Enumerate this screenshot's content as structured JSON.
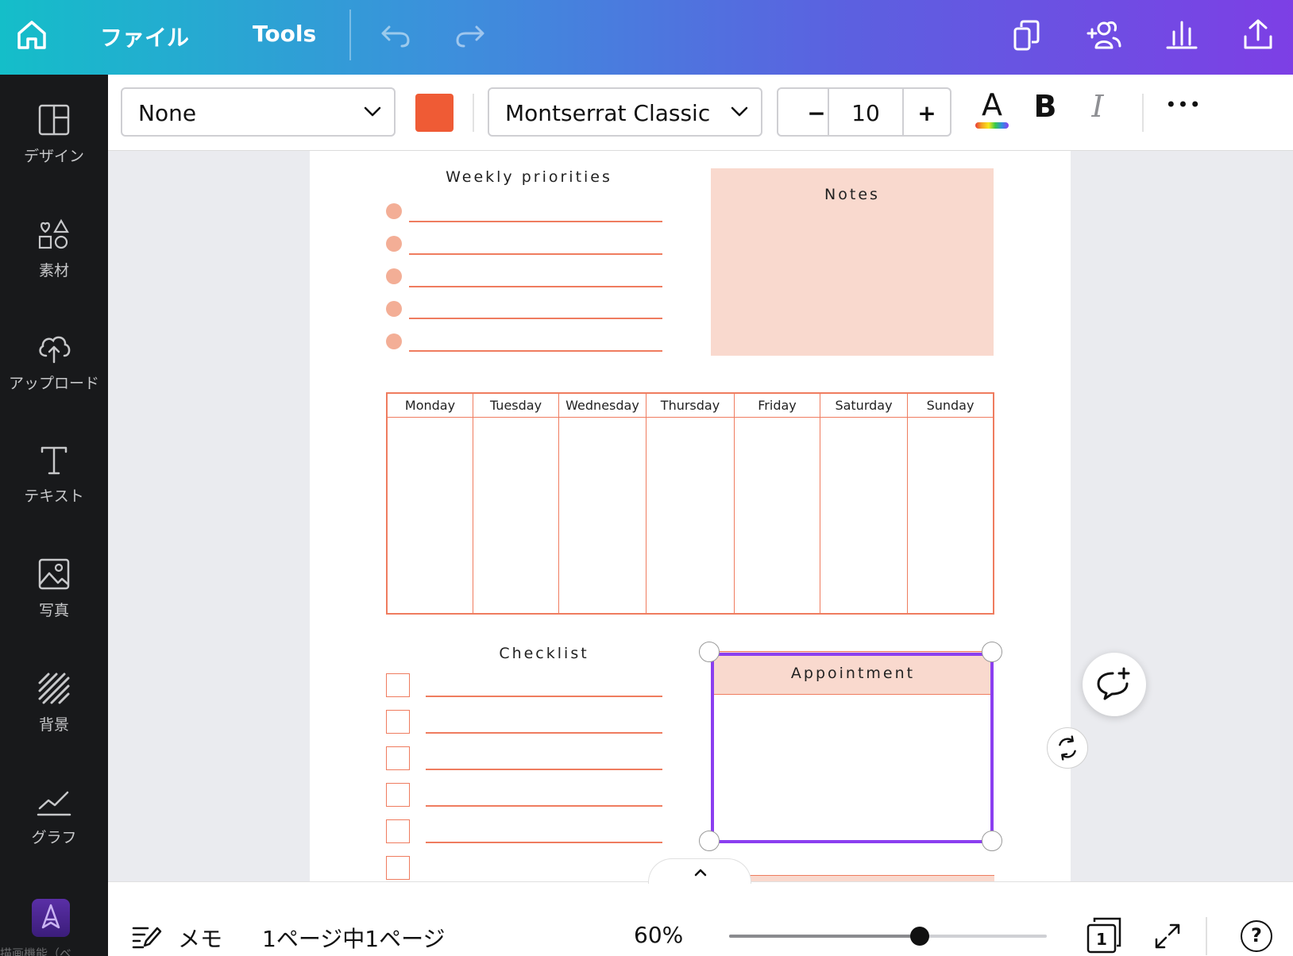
{
  "topbar": {
    "menu_file": "ファイル",
    "menu_tools": "Tools",
    "icons": [
      "home-icon",
      "undo-icon",
      "redo-icon",
      "copy-pages-icon",
      "share-people-icon",
      "chart-icon",
      "upload-share-icon"
    ]
  },
  "sidebar": {
    "items": [
      {
        "label": "デザイン",
        "icon": "layout-icon"
      },
      {
        "label": "素材",
        "icon": "elements-icon"
      },
      {
        "label": "アップロード",
        "icon": "cloud-upload-icon"
      },
      {
        "label": "テキスト",
        "icon": "text-icon"
      },
      {
        "label": "写真",
        "icon": "photo-icon"
      },
      {
        "label": "背景",
        "icon": "background-icon"
      },
      {
        "label": "グラフ",
        "icon": "graph-icon"
      }
    ],
    "app_label": "描画機能（ベ"
  },
  "toolbar": {
    "style_select": "None",
    "color_swatch": "#ef5b35",
    "font_select": "Montserrat Classic",
    "font_size": "10",
    "decrease_label": "−",
    "increase_label": "+",
    "text_color_letter": "A",
    "bold_label": "B",
    "italic_label": "I",
    "more_label": "•••"
  },
  "page": {
    "weekly_priorities": "Weekly priorities",
    "notes": "Notes",
    "days": [
      "Monday",
      "Tuesday",
      "Wednesday",
      "Thursday",
      "Friday",
      "Saturday",
      "Sunday"
    ],
    "checklist": "Checklist",
    "appointment": "Appointment",
    "accent_color": "#ef7c5f",
    "fill_color": "#f9d9ce",
    "selection_color": "#8b3ff0"
  },
  "bottombar": {
    "notes_label": "メモ",
    "page_indicator": "1ページ中1ページ",
    "zoom": "60%",
    "zoom_value": 0.6,
    "page_count": "1",
    "help_label": "?",
    "expand_label": "^"
  }
}
